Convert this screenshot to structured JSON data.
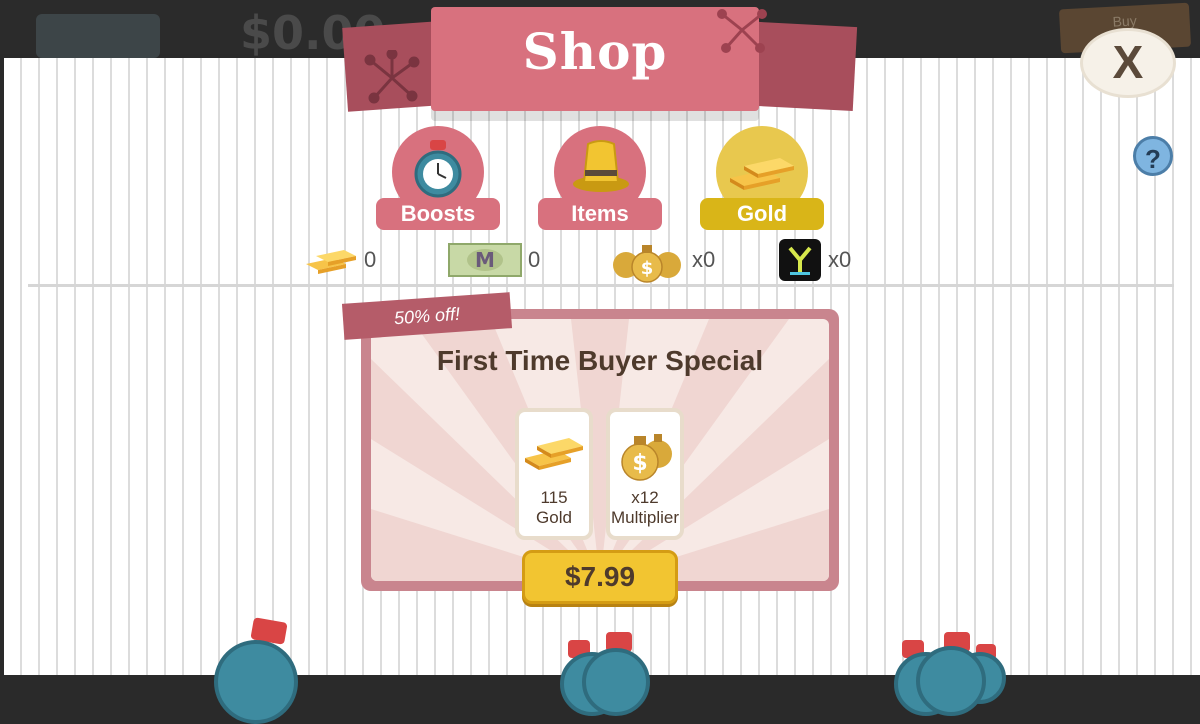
{
  "background": {
    "money": "$0.00",
    "buy_label": "Buy"
  },
  "header": {
    "title": "Shop",
    "close_label": "X",
    "help_label": "?"
  },
  "tabs": [
    {
      "label": "Boosts",
      "icon": "stopwatch-icon",
      "color": "#d8717e",
      "active": false
    },
    {
      "label": "Items",
      "icon": "top-hat-icon",
      "color": "#d8717e",
      "active": false
    },
    {
      "label": "Gold",
      "icon": "gold-bars-icon",
      "color": "#d9b518",
      "active": true
    }
  ],
  "resources": [
    {
      "icon": "gold-bars-icon",
      "value": "0"
    },
    {
      "icon": "megabucks-bill-icon",
      "value": "0"
    },
    {
      "icon": "money-bags-icon",
      "value": "x0"
    },
    {
      "icon": "y-badge-icon",
      "value": "x0"
    }
  ],
  "offer": {
    "ribbon": "50% off!",
    "title": "First Time Buyer Special",
    "items": [
      {
        "icon": "gold-bars-icon",
        "amount": "115",
        "name": "Gold"
      },
      {
        "icon": "money-bags-icon",
        "amount": "x12",
        "name": "Multiplier"
      }
    ],
    "price": "$7.99"
  },
  "colors": {
    "accent": "#d8717e",
    "accent_dark": "#a84e5c",
    "gold": "#f2c531",
    "text": "#4e3a2c"
  }
}
